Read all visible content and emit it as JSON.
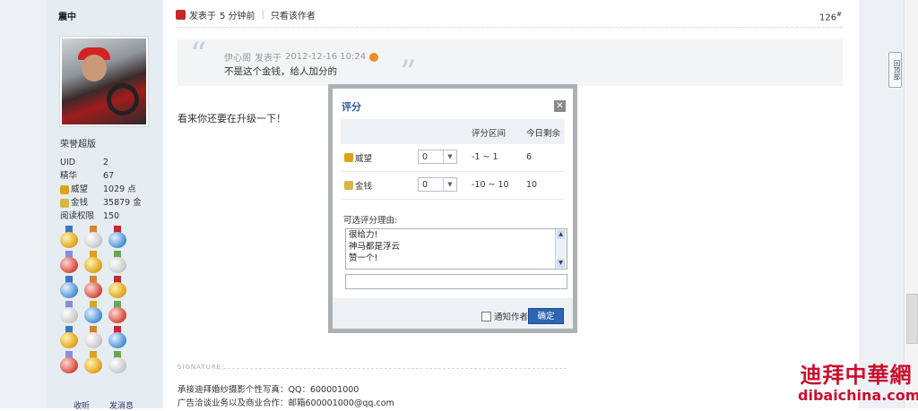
{
  "profile": {
    "username": "震中",
    "rank": "荣誉超版",
    "stats": [
      {
        "key": "UID",
        "value": "2",
        "icon": ""
      },
      {
        "key": "精华",
        "value": "67",
        "icon": ""
      },
      {
        "key": "威望",
        "value": "1029 点",
        "icon": "prestige-icon"
      },
      {
        "key": "金钱",
        "value": "35879 金",
        "icon": "money-icon"
      },
      {
        "key": "阅读权限",
        "value": "150",
        "icon": ""
      }
    ],
    "medal_count": 18,
    "favorite_label": "收听",
    "message_label": "发消息"
  },
  "post": {
    "posted_label": "发表于",
    "posted_time": "5 分钟前",
    "only_author_label": "只看该作者",
    "floor_number": "126",
    "floor_suffix": "#",
    "quote_author": "伊心阁",
    "quote_posted_label": "发表于",
    "quote_time": "2012-12-16 10:24",
    "quote_text": "不是这个金钱，给人加分的",
    "reply_text": "看来你还要在升级一下！",
    "signature_label": "SIGNATURE",
    "signature_line1": "承接迪拜婚纱摄影个性写真：QQ：600001000",
    "signature_line2": "广告洽谈业务以及商业合作：邮箱600001000@qq.com"
  },
  "back_to_top": "回顶部",
  "rating_dialog": {
    "title": "评分",
    "close_label": "✕",
    "col_range": "评分区间",
    "col_remaining": "今日剩余",
    "rows": [
      {
        "label": "威望",
        "value": "0",
        "range": "-1 ~ 1",
        "remaining": "6",
        "icon": "prestige-icon"
      },
      {
        "label": "金钱",
        "value": "0",
        "range": "-10 ~ 10",
        "remaining": "10",
        "icon": "money-icon"
      }
    ],
    "reason_label": "可选评分理由:",
    "reasons": [
      "很给力!",
      "神马都是浮云",
      "赞一个!"
    ],
    "reason_input": "",
    "notify_label": "通知作者",
    "confirm_label": "确定"
  },
  "watermark": {
    "cn": "迪拜中華網",
    "en": "dibaichina.com"
  },
  "colors": {
    "accent": "#2a5d9f",
    "button": "#2d64b3",
    "side_bg": "#e5edf2",
    "brand_red": "#c8102e"
  }
}
